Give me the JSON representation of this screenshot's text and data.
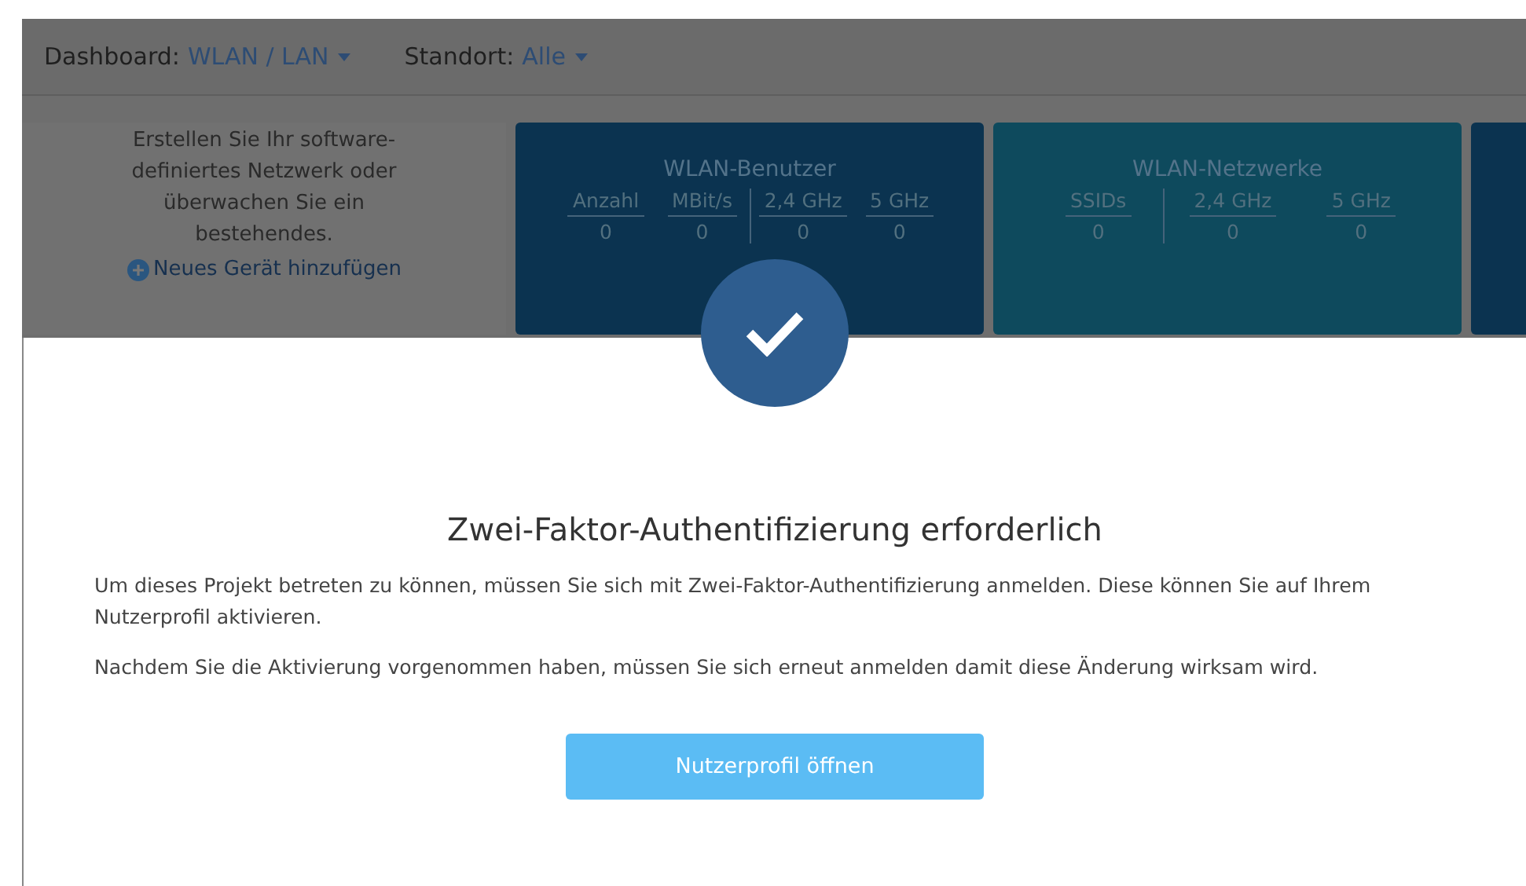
{
  "header": {
    "filters": [
      {
        "label": "Dashboard:",
        "value": "WLAN / LAN"
      },
      {
        "label": "Standort:",
        "value": "Alle"
      }
    ]
  },
  "intro": {
    "text": "Erstellen Sie Ihr software-definiertes Netzwerk oder überwachen Sie ein bestehendes.",
    "link": "Neues Gerät hinzufügen"
  },
  "stat_cards": [
    {
      "title": "WLAN-Benutzer",
      "color": "#0b3350",
      "groups": [
        [
          {
            "label": "Anzahl",
            "value": "0"
          },
          {
            "label": "MBit/s",
            "value": "0"
          }
        ],
        [
          {
            "label": "2,4 GHz",
            "value": "0"
          },
          {
            "label": "5 GHz",
            "value": "0"
          }
        ]
      ]
    },
    {
      "title": "WLAN-Netzwerke",
      "color": "#0e4a5d",
      "groups": [
        [
          {
            "label": "SSIDs",
            "value": "0"
          }
        ],
        [
          {
            "label": "2,4 GHz",
            "value": "0"
          },
          {
            "label": "5 GHz",
            "value": "0"
          }
        ]
      ]
    }
  ],
  "modal": {
    "title": "Zwei-Faktor-Authentifizierung erforderlich",
    "paragraphs": [
      "Um dieses Projekt betreten zu können, müssen Sie sich mit Zwei-Faktor-Authentifizierung anmelden. Diese können Sie auf Ihrem Nutzerprofil aktivieren.",
      "Nachdem Sie die Aktivierung vorgenommen haben, müssen Sie sich erneut anmelden damit diese Änderung wirksam wird."
    ],
    "button": "Nutzerprofil öffnen"
  }
}
